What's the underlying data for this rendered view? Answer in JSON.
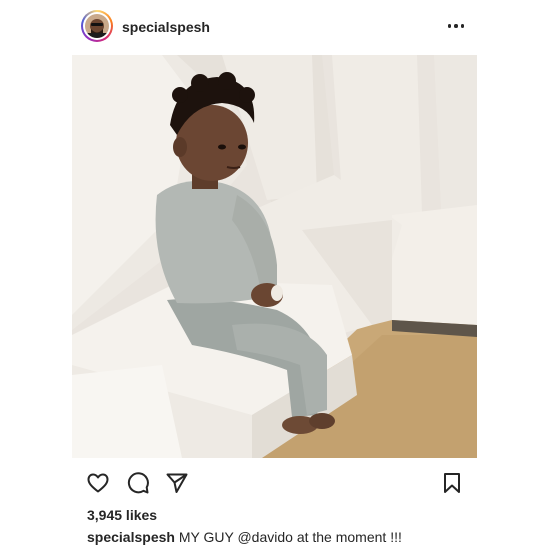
{
  "post": {
    "username": "specialspesh",
    "more_icon": "more-horizontal-icon",
    "photo_description_icon": "photo"
  },
  "actions": {
    "like_icon": "heart-icon",
    "comment_icon": "comment-icon",
    "share_icon": "send-icon",
    "save_icon": "bookmark-icon"
  },
  "likes": "3,945 likes",
  "caption": {
    "username": "specialspesh",
    "text_before": "MY GUY",
    "mention": "@davido",
    "text_after": "at the moment !!!"
  },
  "colors": {
    "text": "#262626",
    "background": "#ffffff"
  }
}
